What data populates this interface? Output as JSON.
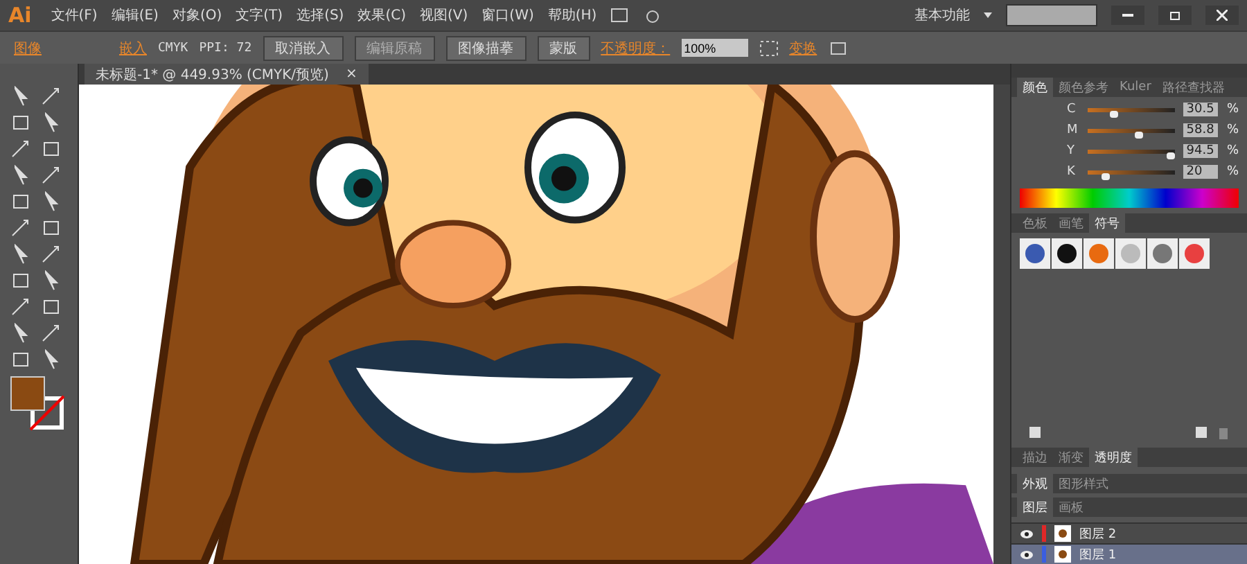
{
  "menubar": {
    "logo": "Ai",
    "menus": [
      "文件(F)",
      "编辑(E)",
      "对象(O)",
      "文字(T)",
      "选择(S)",
      "效果(C)",
      "视图(V)",
      "窗口(W)",
      "帮助(H)"
    ],
    "workspace": "基本功能"
  },
  "control_bar": {
    "label": "图像",
    "embed_link": "嵌入",
    "color_mode": "CMYK",
    "ppi": "PPI: 72",
    "buttons": [
      {
        "label": "取消嵌入",
        "disabled": false
      },
      {
        "label": "编辑原稿",
        "disabled": true
      },
      {
        "label": "图像描摹",
        "disabled": false
      },
      {
        "label": "蒙版",
        "disabled": false
      }
    ],
    "opacity_label": "不透明度：",
    "opacity_value": "100%",
    "transform_link": "变换"
  },
  "document_tab": {
    "title": "未标题-1* @ 449.93% (CMYK/预览)",
    "close": "×"
  },
  "color_panel": {
    "tabs": [
      {
        "label": "颜色",
        "selected": true
      },
      {
        "label": "颜色参考",
        "selected": false
      },
      {
        "label": "Kuler",
        "selected": false
      },
      {
        "label": "路径查找器",
        "selected": false
      }
    ],
    "channels": [
      {
        "name": "C",
        "level": 0.31,
        "value": "30.5",
        "unit": "%"
      },
      {
        "name": "M",
        "level": 0.59,
        "value": "58.8",
        "unit": "%"
      },
      {
        "name": "Y",
        "level": 0.95,
        "value": "94.5",
        "unit": "%"
      },
      {
        "name": "K",
        "level": 0.2,
        "value": "20",
        "unit": "%"
      }
    ]
  },
  "swatch_panel": {
    "tabs": [
      {
        "label": "色板",
        "selected": false
      },
      {
        "label": "画笔",
        "selected": false
      },
      {
        "label": "符号",
        "selected": true
      }
    ]
  },
  "stroke_panel": {
    "tabs": [
      {
        "label": "描边",
        "selected": false
      },
      {
        "label": "渐变",
        "selected": false
      },
      {
        "label": "透明度",
        "selected": true
      }
    ]
  },
  "appearance_panel": {
    "tabs": [
      {
        "label": "外观",
        "selected": true
      },
      {
        "label": "图形样式",
        "selected": false
      }
    ]
  },
  "layers_panel": {
    "tabs": [
      {
        "label": "图层",
        "selected": true
      },
      {
        "label": "画板",
        "selected": false
      }
    ],
    "layers": [
      {
        "name": "图层 2",
        "selected": false,
        "color": "#e02828"
      },
      {
        "name": "图层 1",
        "selected": true,
        "color": "#3a5ee0"
      }
    ]
  }
}
